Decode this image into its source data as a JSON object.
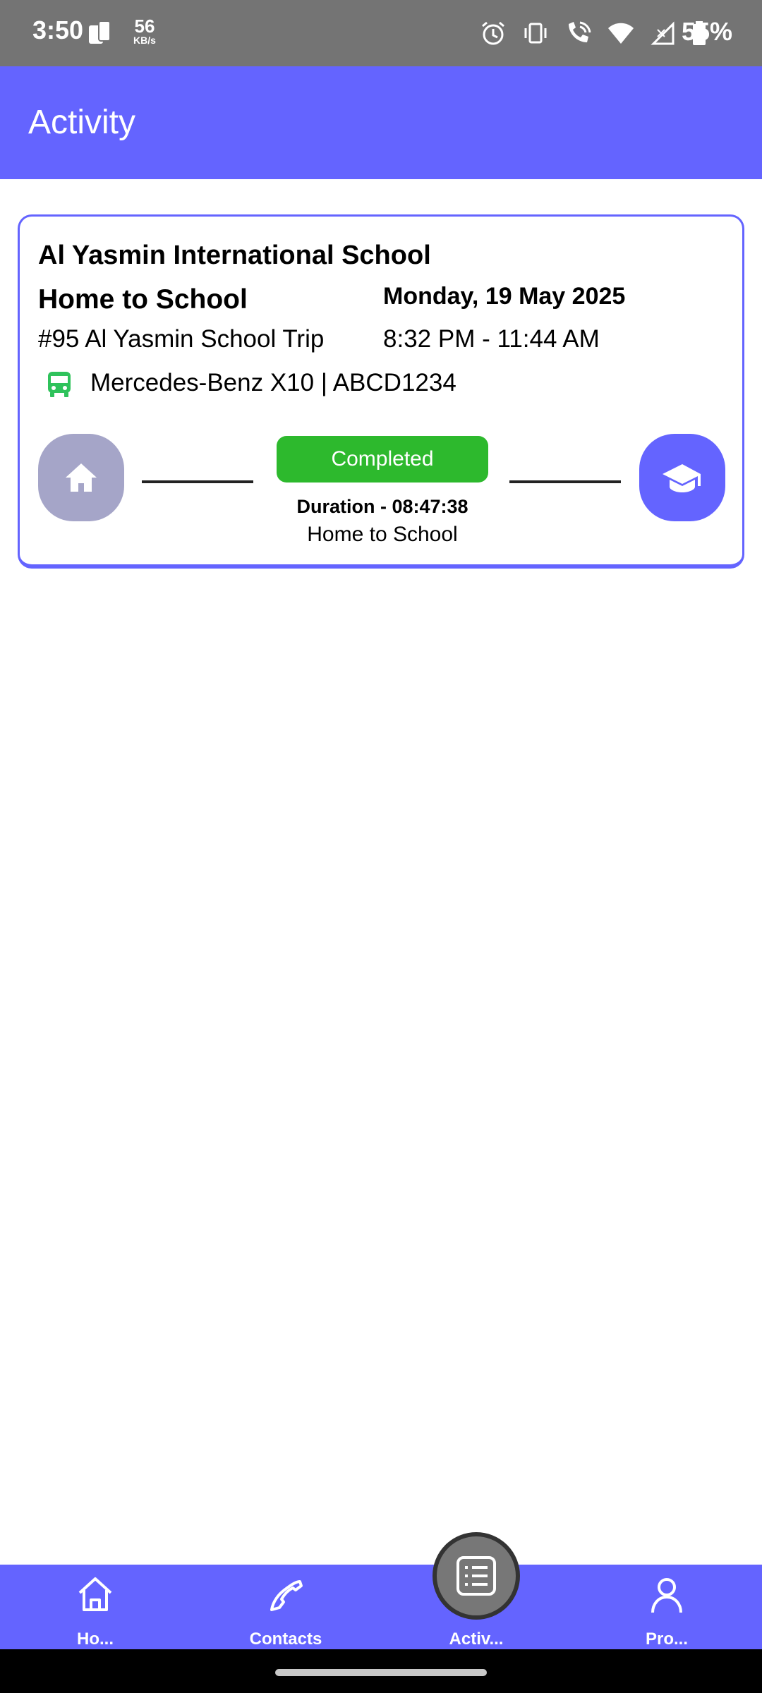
{
  "status_bar": {
    "time": "3:50",
    "net_speed": "56",
    "net_unit": "KB/s",
    "battery": "55%"
  },
  "app_bar": {
    "title": "Activity"
  },
  "trip": {
    "school": "Al Yasmin International School",
    "route": "Home to School",
    "date": "Monday, 19 May 2025",
    "trip_number": "#95 Al Yasmin School Trip",
    "time_range": "8:32 PM - 11:44 AM",
    "vehicle": "Mercedes-Benz X10 | ABCD1234",
    "status": "Completed",
    "duration": "Duration - 08:47:38",
    "route_label": "Home to School",
    "start_icon": "home-icon",
    "end_icon": "graduation-cap-icon",
    "vehicle_icon": "bus-icon"
  },
  "nav": {
    "items": [
      {
        "label": "Ho...",
        "icon": "home-outline-icon"
      },
      {
        "label": "Contacts",
        "icon": "phone-icon"
      },
      {
        "label": "Activ...",
        "icon": "list-icon",
        "active": true
      },
      {
        "label": "Pro...",
        "icon": "person-icon"
      }
    ]
  },
  "colors": {
    "primary": "#6464ff",
    "status_completed": "#2db92d",
    "home_circle": "#a5a5c8",
    "bus_icon": "#2fc25b",
    "status_bar": "#747474"
  }
}
